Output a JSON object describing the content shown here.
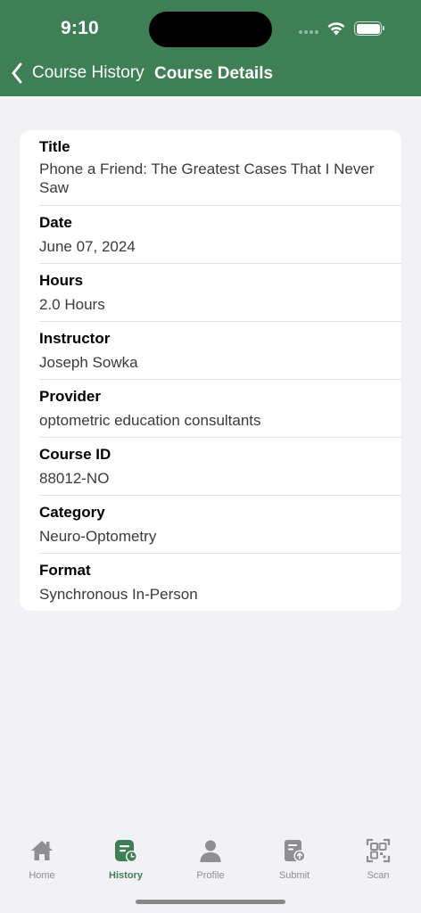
{
  "status_bar": {
    "time": "9:10"
  },
  "nav": {
    "back_label": "Course History",
    "title": "Course Details"
  },
  "details": [
    {
      "label": "Title",
      "value": "Phone a Friend: The Greatest Cases That I Never Saw"
    },
    {
      "label": "Date",
      "value": "June 07, 2024"
    },
    {
      "label": "Hours",
      "value": "2.0 Hours"
    },
    {
      "label": "Instructor",
      "value": "Joseph Sowka"
    },
    {
      "label": "Provider",
      "value": "optometric education consultants"
    },
    {
      "label": "Course ID",
      "value": "88012-NO"
    },
    {
      "label": "Category",
      "value": "Neuro-Optometry"
    },
    {
      "label": "Format",
      "value": "Synchronous In-Person"
    }
  ],
  "tabs": [
    {
      "label": "Home",
      "icon": "home-icon"
    },
    {
      "label": "History",
      "icon": "history-icon",
      "active": true
    },
    {
      "label": "Profile",
      "icon": "profile-icon"
    },
    {
      "label": "Submit",
      "icon": "submit-icon"
    },
    {
      "label": "Scan",
      "icon": "qr-scan-icon"
    }
  ],
  "colors": {
    "accent": "#3f7f55",
    "inactive": "#8e8e93",
    "background": "#f2f1f6"
  }
}
